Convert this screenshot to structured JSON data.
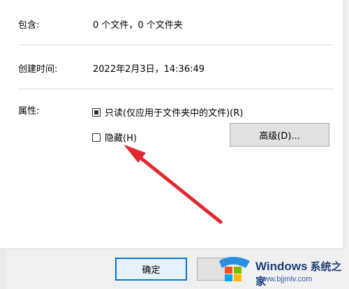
{
  "properties": {
    "contains_label": "包含:",
    "contains_value": "0 个文件，0 个文件夹",
    "created_label": "创建时间:",
    "created_value": "2022年2月3日，14:36:49",
    "attributes_label": "属性:",
    "readonly_label": "只读(仅应用于文件夹中的文件)(R)",
    "readonly_state": "indeterminate",
    "hidden_label": "隐藏(H)",
    "hidden_checked": false,
    "advanced_button": "高级(D)..."
  },
  "footer": {
    "ok_button": "确定"
  },
  "watermark": {
    "title": "Windows",
    "title_cn": "系统之家",
    "url": "www.bjjmlv.com"
  },
  "colors": {
    "accent": "#0078d7",
    "arrow": "#e0282e"
  }
}
